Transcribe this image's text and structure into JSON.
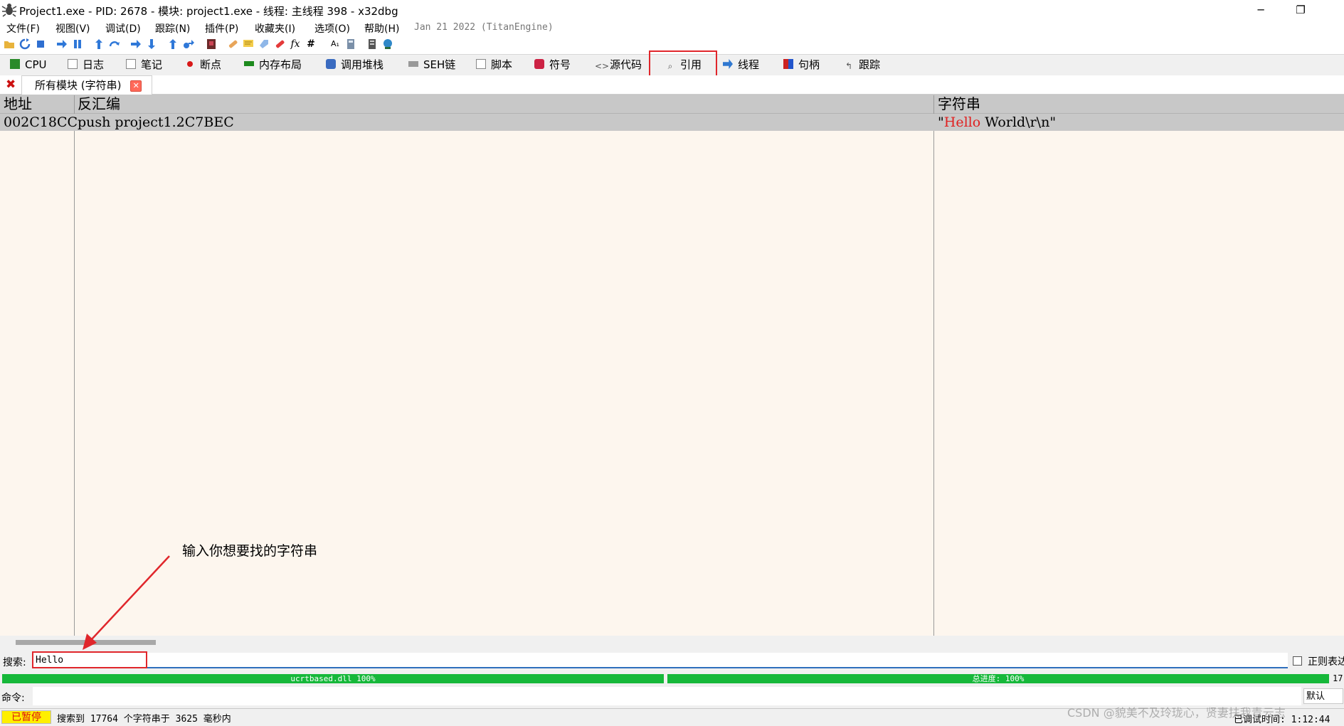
{
  "window": {
    "title": "Project1.exe - PID: 2678 - 模块: project1.exe - 线程: 主线程 398 - x32dbg",
    "minimize_glyph": "─",
    "restore_glyph": "❐"
  },
  "menu": {
    "items": [
      "文件(F)",
      "视图(V)",
      "调试(D)",
      "跟踪(N)",
      "插件(P)",
      "收藏夹(I)",
      "选项(O)",
      "帮助(H)"
    ],
    "build_info": "Jan 21 2022 (TitanEngine)"
  },
  "toolbar": {
    "icons": [
      "open-icon",
      "restart-icon",
      "stop-icon",
      "run-icon",
      "pause-icon",
      "step-into-icon",
      "step-over-icon",
      "trace-into-icon",
      "trace-over-icon",
      "execute-till-return-icon",
      "run-to-user-code-icon",
      "scylla-icon",
      "patch-icon",
      "comments-icon",
      "labels-icon",
      "bookmarks-icon",
      "functions-icon",
      "variables-icon",
      "font-icon",
      "calculator-icon",
      "help-icon",
      "about-icon"
    ],
    "function_glyph": "fx",
    "hash_glyph": "#",
    "font_glyph": "A₁"
  },
  "tabs": [
    {
      "label": "CPU",
      "icon": "cpu-icon",
      "color": "#2a8a2a"
    },
    {
      "label": "日志",
      "icon": "log-icon",
      "color": "#777777"
    },
    {
      "label": "笔记",
      "icon": "notes-icon",
      "color": "#777777"
    },
    {
      "label": "断点",
      "icon": "breakpoint-icon",
      "color": "#d81818"
    },
    {
      "label": "内存布局",
      "icon": "memory-map-icon",
      "color": "#1d8a1d"
    },
    {
      "label": "调用堆栈",
      "icon": "call-stack-icon",
      "color": "#3a6bc0"
    },
    {
      "label": "SEH链",
      "icon": "seh-icon",
      "color": "#777777"
    },
    {
      "label": "脚本",
      "icon": "script-icon",
      "color": "#777777"
    },
    {
      "label": "符号",
      "icon": "symbols-icon",
      "color": "#cc2244"
    },
    {
      "label": "源代码",
      "icon": "source-icon",
      "color": "#555555"
    },
    {
      "label": "引用",
      "icon": "references-icon",
      "color": "#555555"
    },
    {
      "label": "线程",
      "icon": "threads-icon",
      "color": "#2f78d0"
    },
    {
      "label": "句柄",
      "icon": "handles-icon",
      "color": "#cc2222"
    },
    {
      "label": "跟踪",
      "icon": "trace-icon",
      "color": "#555555"
    }
  ],
  "sub_tab": {
    "label": "所有模块 (字符串)",
    "close_glyph": "✕",
    "panel_close_glyph": "✖"
  },
  "table": {
    "columns": [
      "地址",
      "反汇编",
      "字符串"
    ],
    "rows": [
      {
        "address": "002C18CC",
        "disasm": "push project1.2C7BEC",
        "string_quote_open": "\"",
        "string_match": "Hello",
        "string_rest": " World\\r\\n\""
      }
    ],
    "match_color": "#e02020"
  },
  "annotation": {
    "text": "输入你想要找的字符串",
    "color": "#e0262b"
  },
  "search": {
    "label": "搜索:",
    "value": "Hello",
    "regex_label": "正则表达"
  },
  "progress": {
    "left_label": "ucrtbased.dll 100%",
    "right_label": "总进度: 100%",
    "left_fraction": 1.0,
    "right_fraction": 1.0,
    "count": "17"
  },
  "command": {
    "label": "命令:",
    "value": "",
    "mode": "默认"
  },
  "status": {
    "state": "已暂停",
    "message": "搜索到 17764 个字符串于 3625 毫秒内",
    "elapsed": "已调试时间: 1:12:44",
    "watermark": "CSDN @貌美不及玲珑心，贤妻扶我青云志"
  }
}
